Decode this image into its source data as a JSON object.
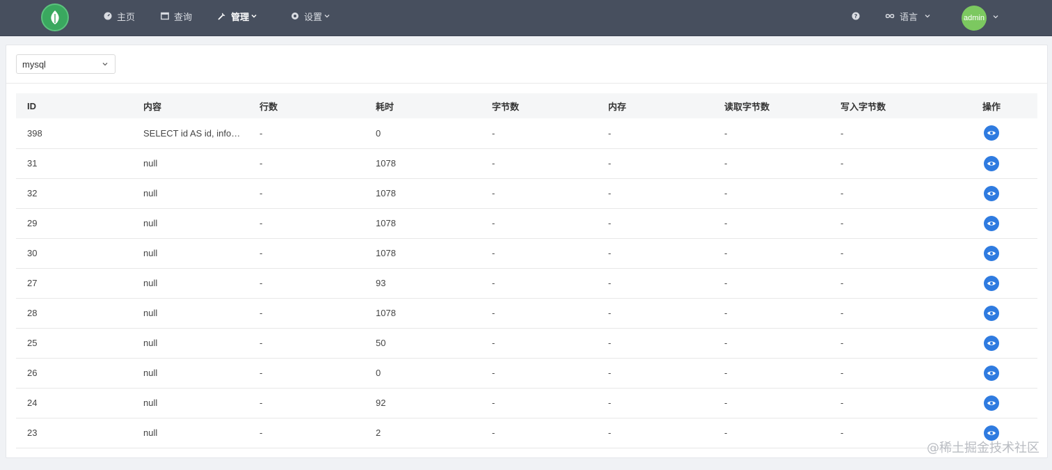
{
  "nav": {
    "items": [
      {
        "label": "主页",
        "icon": "dashboard-icon"
      },
      {
        "label": "查询",
        "icon": "window-icon"
      },
      {
        "label": "管理",
        "icon": "wrench-icon",
        "active": true,
        "has_dropdown": true
      },
      {
        "label": "设置",
        "icon": "settings-icon",
        "has_dropdown": true
      }
    ],
    "help_icon": "question-circle-icon",
    "language": {
      "label": "语言",
      "icon": "infinity-icon"
    },
    "user": {
      "avatar_label": "admin"
    }
  },
  "toolbar": {
    "source_select": {
      "value": "mysql"
    }
  },
  "table": {
    "columns": [
      "ID",
      "内容",
      "行数",
      "耗时",
      "字节数",
      "内存",
      "读取字节数",
      "写入字节数",
      "操作"
    ],
    "rows": [
      [
        "398",
        "SELECT id AS id, info…",
        "-",
        "0",
        "-",
        "-",
        "-",
        "-"
      ],
      [
        "31",
        "null",
        "-",
        "1078",
        "-",
        "-",
        "-",
        "-"
      ],
      [
        "32",
        "null",
        "-",
        "1078",
        "-",
        "-",
        "-",
        "-"
      ],
      [
        "29",
        "null",
        "-",
        "1078",
        "-",
        "-",
        "-",
        "-"
      ],
      [
        "30",
        "null",
        "-",
        "1078",
        "-",
        "-",
        "-",
        "-"
      ],
      [
        "27",
        "null",
        "-",
        "93",
        "-",
        "-",
        "-",
        "-"
      ],
      [
        "28",
        "null",
        "-",
        "1078",
        "-",
        "-",
        "-",
        "-"
      ],
      [
        "25",
        "null",
        "-",
        "50",
        "-",
        "-",
        "-",
        "-"
      ],
      [
        "26",
        "null",
        "-",
        "0",
        "-",
        "-",
        "-",
        "-"
      ],
      [
        "24",
        "null",
        "-",
        "92",
        "-",
        "-",
        "-",
        "-"
      ],
      [
        "23",
        "null",
        "-",
        "2",
        "-",
        "-",
        "-",
        "-"
      ]
    ],
    "action_icon": "eye-icon"
  },
  "colors": {
    "topbar": "#474f5e",
    "accent": "#2f7be0",
    "avatar": "#7cc860",
    "logo": "#3aa85f"
  },
  "footer": {
    "watermark": "@稀土掘金技术社区"
  }
}
